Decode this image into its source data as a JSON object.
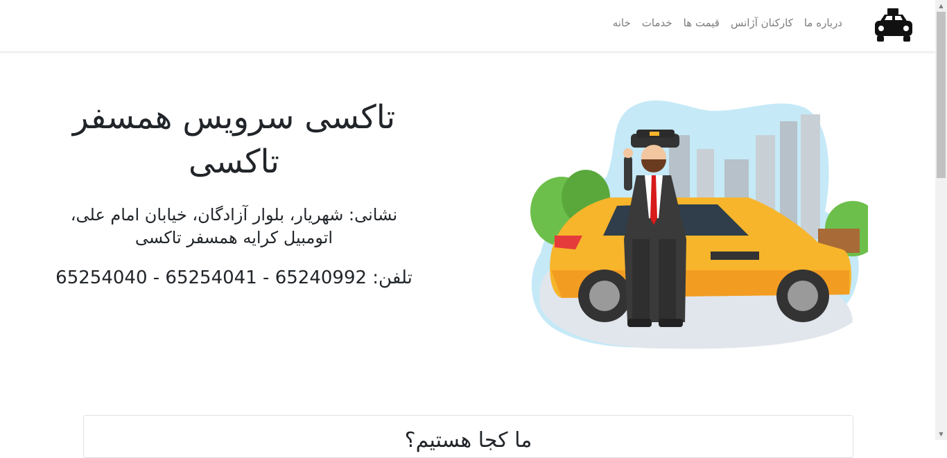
{
  "navbar": {
    "brand_icon": "taxi-icon",
    "links": [
      {
        "label": "خانه"
      },
      {
        "label": "خدمات"
      },
      {
        "label": "قیمت ها"
      },
      {
        "label": "کارکنان آژانس"
      },
      {
        "label": "درباره ما"
      }
    ]
  },
  "hero": {
    "title": "تاکسی سرویس همسفر تاکسی",
    "address": "نشانی: شهریار، بلوار آزادگان، خیابان امام علی، اتومبیل کرایه همسفر تاکسی",
    "phone": "تلفن: 65240992 - 65254041 - 65254040",
    "illustration_icon": "taxi-driver-illustration"
  },
  "section": {
    "title": "ما کجا هستیم؟"
  },
  "colors": {
    "taxi_yellow": "#f7b52c",
    "nav_text": "#7b7b7b",
    "sky_blob": "#bfe6f5",
    "tree_green": "#6cbf4b"
  }
}
